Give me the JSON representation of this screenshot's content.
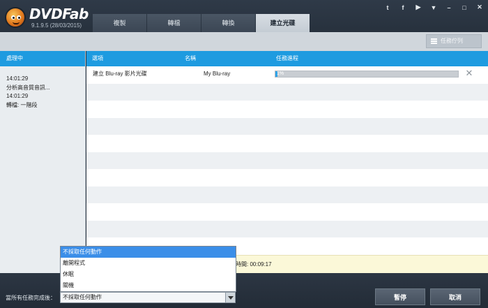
{
  "app": {
    "title": "DVDFab",
    "version": "9.1.9.5 (28/03/2015)"
  },
  "tabs": [
    {
      "label": "複製"
    },
    {
      "label": "轉檔"
    },
    {
      "label": "轉換"
    },
    {
      "label": "建立光碟"
    }
  ],
  "active_tab": "建立光碟",
  "window_controls": {
    "twitter": "t",
    "facebook": "f",
    "youtube": "▶",
    "menu": "▼",
    "minimize": "–",
    "maximize": "□",
    "close": "✕"
  },
  "toolbar": {
    "task_queue_label": "任務佇列"
  },
  "left_panel": {
    "header": "處理中",
    "log": [
      "14:01:29",
      "分析高音質音訊...",
      "14:01:29",
      "轉檔: 一階段"
    ]
  },
  "table": {
    "columns": [
      "選項",
      "名稱",
      "任務進程"
    ],
    "tasks": [
      {
        "option": "建立 Blu-ray 影片光碟",
        "name": "My Blu-ray",
        "progress_label": "1%",
        "progress": 0.01
      }
    ]
  },
  "status": {
    "elapsed": "時間: 00:09:17"
  },
  "bottom": {
    "after_label": "當所有任務完成後：",
    "after_value": "不採取任何動作",
    "after_options": [
      "不採取任何動作",
      "離開程式",
      "休眠",
      "關機"
    ],
    "pause_label": "暫停",
    "cancel_label": "取消"
  },
  "colors": {
    "accent": "#1e9be0",
    "progress": "#2da3e8",
    "dropdown_highlight": "#3b8ee8",
    "status_bar": "#fbf8d8"
  }
}
